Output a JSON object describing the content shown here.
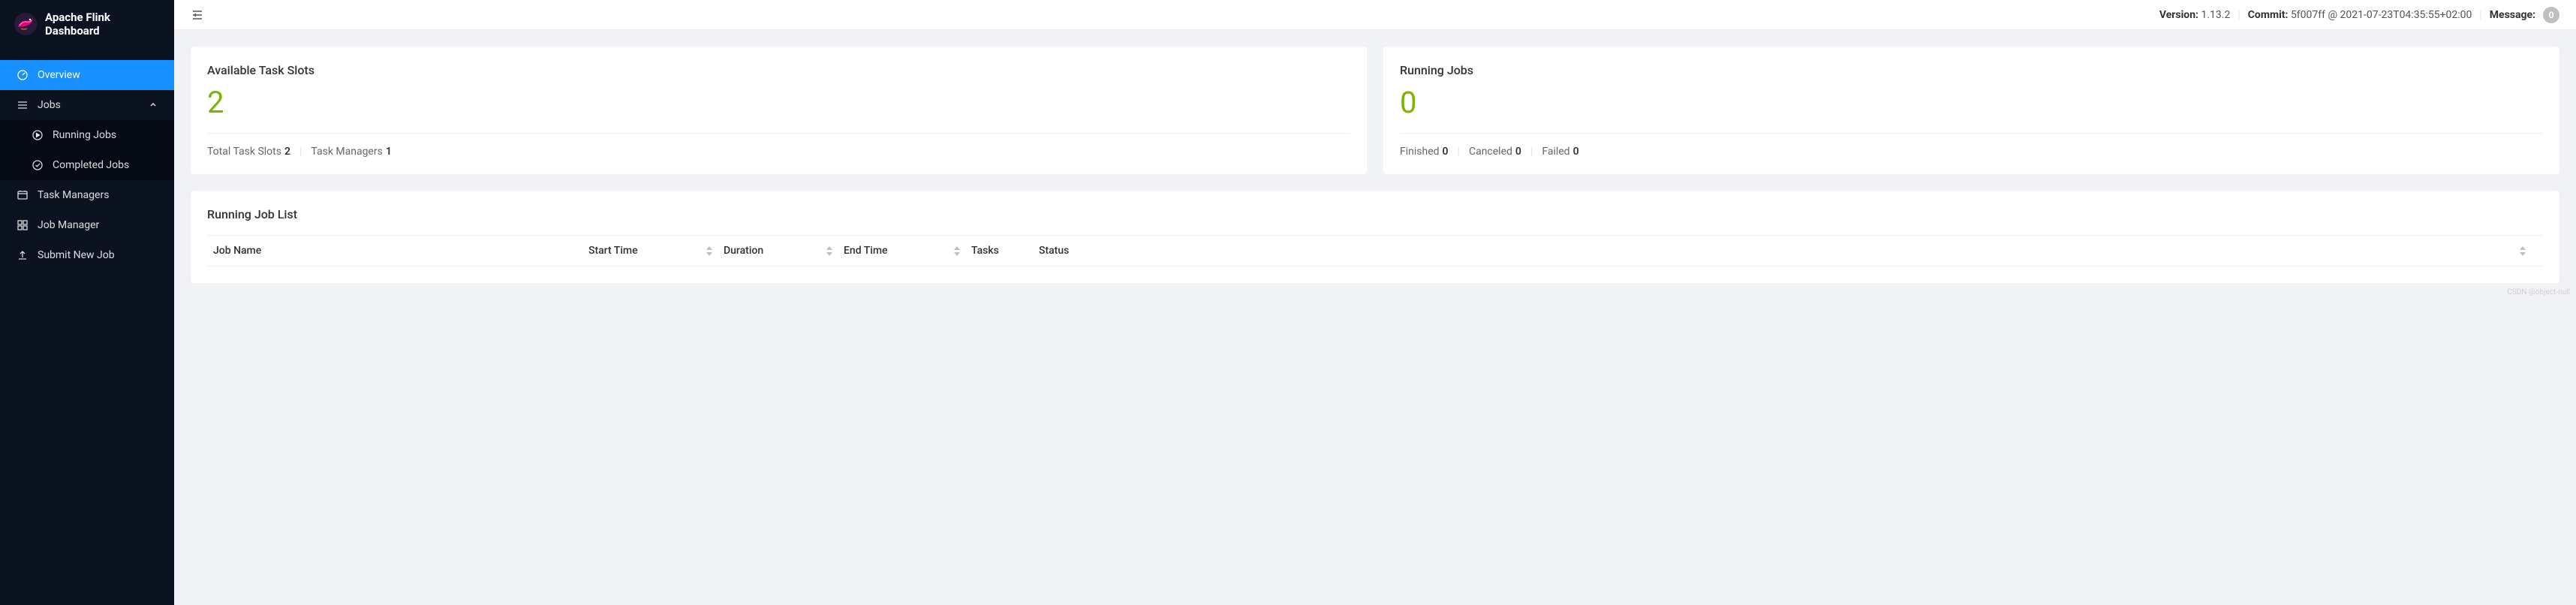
{
  "sidebar": {
    "title": "Apache Flink Dashboard",
    "items": [
      {
        "label": "Overview"
      },
      {
        "label": "Jobs"
      },
      {
        "label": "Task Managers"
      },
      {
        "label": "Job Manager"
      },
      {
        "label": "Submit New Job"
      }
    ],
    "jobs_sub": [
      {
        "label": "Running Jobs"
      },
      {
        "label": "Completed Jobs"
      }
    ]
  },
  "topbar": {
    "version_label": "Version:",
    "version_value": "1.13.2",
    "commit_label": "Commit:",
    "commit_value": "5f007ff @ 2021-07-23T04:35:55+02:00",
    "message_label": "Message:",
    "message_count": "0"
  },
  "cards": {
    "slots": {
      "title": "Available Task Slots",
      "value": "2",
      "total_label": "Total Task Slots",
      "total_value": "2",
      "managers_label": "Task Managers",
      "managers_value": "1"
    },
    "jobs": {
      "title": "Running Jobs",
      "value": "0",
      "finished_label": "Finished",
      "finished_value": "0",
      "canceled_label": "Canceled",
      "canceled_value": "0",
      "failed_label": "Failed",
      "failed_value": "0"
    }
  },
  "job_list": {
    "title": "Running Job List",
    "columns": {
      "job_name": "Job Name",
      "start_time": "Start Time",
      "duration": "Duration",
      "end_time": "End Time",
      "tasks": "Tasks",
      "status": "Status"
    }
  },
  "watermark": "CSDN @object-null"
}
